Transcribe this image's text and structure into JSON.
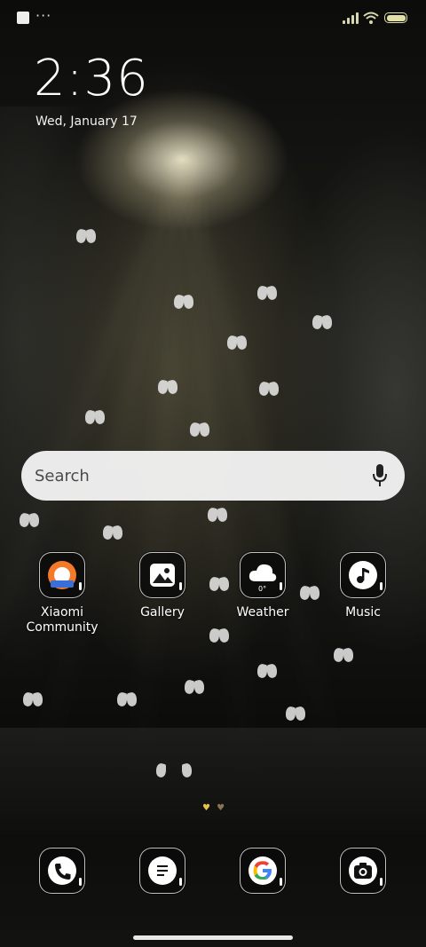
{
  "status_bar": {
    "notification_icon": "square-notification-icon",
    "more": "···",
    "signal_icon": "signal-icon",
    "wifi_icon": "wifi-icon",
    "battery_icon": "battery-icon",
    "accent_color": "#e2e0a8"
  },
  "lockclock": {
    "time": "2:36",
    "date": "Wed, January 17"
  },
  "search": {
    "placeholder": "Search",
    "mic_icon": "microphone-icon"
  },
  "apps": [
    {
      "label_line1": "Xiaomi",
      "label_line2": "Community",
      "icon": "xiaomi-community-icon"
    },
    {
      "label_line1": "Gallery",
      "icon": "gallery-icon"
    },
    {
      "label_line1": "Weather",
      "icon": "weather-icon",
      "badge": "0°"
    },
    {
      "label_line1": "Music",
      "icon": "music-icon"
    }
  ],
  "pager": {
    "pages": 2,
    "current": 1,
    "indicator_color": "#d9b64a"
  },
  "dock": [
    {
      "icon": "phone-icon"
    },
    {
      "icon": "messages-icon"
    },
    {
      "icon": "google-icon"
    },
    {
      "icon": "camera-icon"
    }
  ]
}
